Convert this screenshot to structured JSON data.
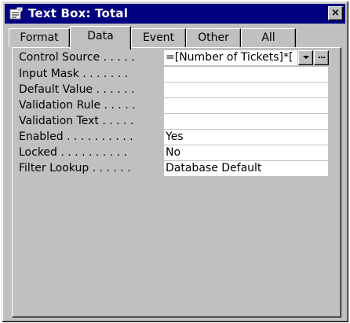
{
  "window": {
    "title": "Text Box: Total",
    "close_label": "×"
  },
  "tabs": [
    {
      "label": "Format",
      "active": false
    },
    {
      "label": "Data",
      "active": true
    },
    {
      "label": "Event",
      "active": false
    },
    {
      "label": "Other",
      "active": false
    },
    {
      "label": "All",
      "active": false
    }
  ],
  "properties": [
    {
      "label": "Control Source . . . . .",
      "value": "=[Number of Tickets]*["
    },
    {
      "label": "Input Mask . . . . . . .",
      "value": ""
    },
    {
      "label": "Default Value . . . . . .",
      "value": ""
    },
    {
      "label": "Validation Rule . . . . .",
      "value": ""
    },
    {
      "label": "Validation Text . . . . .",
      "value": ""
    },
    {
      "label": "Enabled . . . . . . . . . .",
      "value": "Yes"
    },
    {
      "label": "Locked . . . . . . . . . .",
      "value": "No"
    },
    {
      "label": "Filter Lookup . . . . . .",
      "value": "Database Default"
    }
  ],
  "control_source_buttons": {
    "builder_label": "..."
  },
  "icons": {
    "title": "properties-sheet-icon",
    "dropdown": "chevron-down-icon",
    "builder": "ellipsis-icon"
  }
}
